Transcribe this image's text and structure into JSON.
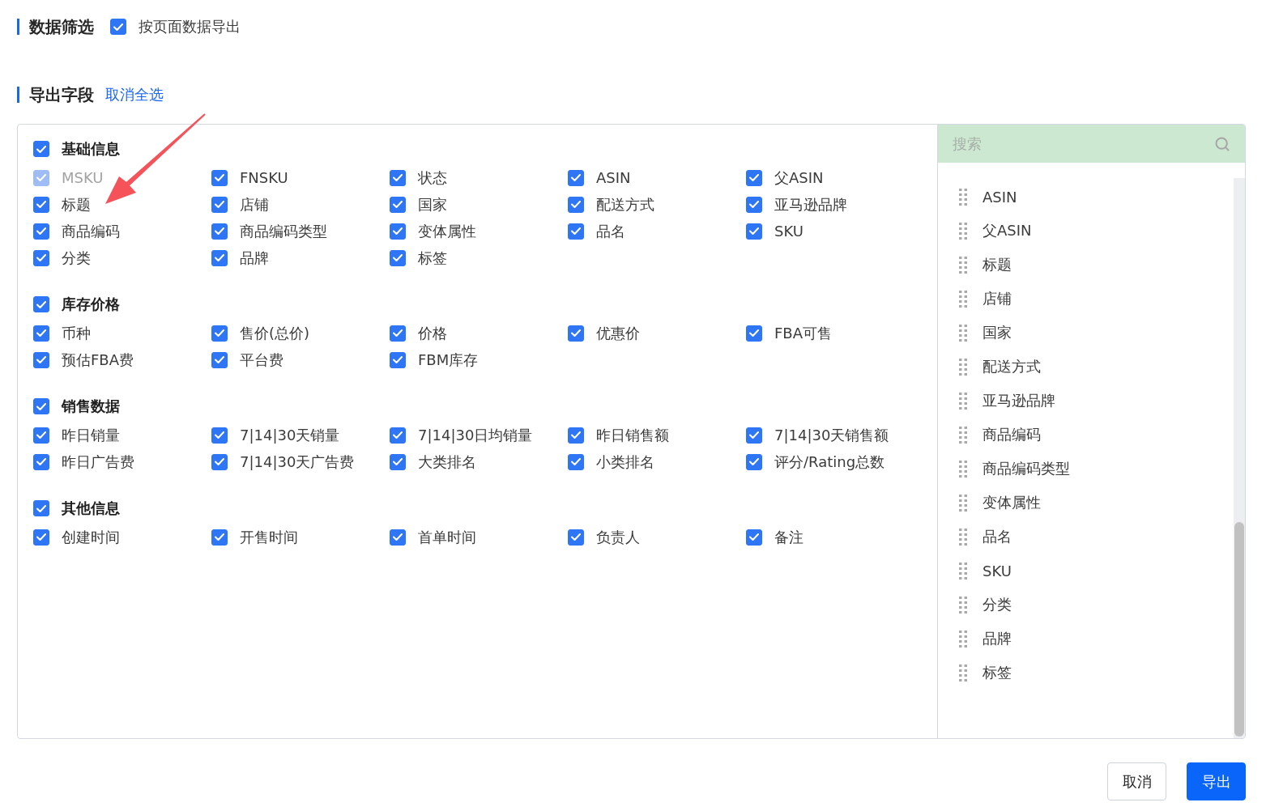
{
  "filter_section": {
    "title": "数据筛选",
    "option": {
      "label": "按页面数据导出",
      "checked": true
    }
  },
  "fields_section": {
    "title": "导出字段",
    "link": "取消全选"
  },
  "field_groups": [
    {
      "title": "基础信息",
      "checked": true,
      "fields": [
        {
          "label": "MSKU",
          "checked": true,
          "disabled": true
        },
        {
          "label": "FNSKU",
          "checked": true,
          "disabled": false
        },
        {
          "label": "状态",
          "checked": true,
          "disabled": false
        },
        {
          "label": "ASIN",
          "checked": true,
          "disabled": false
        },
        {
          "label": "父ASIN",
          "checked": true,
          "disabled": false
        },
        {
          "label": "标题",
          "checked": true,
          "disabled": false
        },
        {
          "label": "店铺",
          "checked": true,
          "disabled": false
        },
        {
          "label": "国家",
          "checked": true,
          "disabled": false
        },
        {
          "label": "配送方式",
          "checked": true,
          "disabled": false
        },
        {
          "label": "亚马逊品牌",
          "checked": true,
          "disabled": false
        },
        {
          "label": "商品编码",
          "checked": true,
          "disabled": false
        },
        {
          "label": "商品编码类型",
          "checked": true,
          "disabled": false
        },
        {
          "label": "变体属性",
          "checked": true,
          "disabled": false
        },
        {
          "label": "品名",
          "checked": true,
          "disabled": false
        },
        {
          "label": "SKU",
          "checked": true,
          "disabled": false
        },
        {
          "label": "分类",
          "checked": true,
          "disabled": false
        },
        {
          "label": "品牌",
          "checked": true,
          "disabled": false
        },
        {
          "label": "标签",
          "checked": true,
          "disabled": false
        }
      ]
    },
    {
      "title": "库存价格",
      "checked": true,
      "fields": [
        {
          "label": "币种",
          "checked": true,
          "disabled": false
        },
        {
          "label": "售价(总价)",
          "checked": true,
          "disabled": false
        },
        {
          "label": "价格",
          "checked": true,
          "disabled": false
        },
        {
          "label": "优惠价",
          "checked": true,
          "disabled": false
        },
        {
          "label": "FBA可售",
          "checked": true,
          "disabled": false
        },
        {
          "label": "预估FBA费",
          "checked": true,
          "disabled": false
        },
        {
          "label": "平台费",
          "checked": true,
          "disabled": false
        },
        {
          "label": "FBM库存",
          "checked": true,
          "disabled": false
        }
      ]
    },
    {
      "title": "销售数据",
      "checked": true,
      "fields": [
        {
          "label": "昨日销量",
          "checked": true,
          "disabled": false
        },
        {
          "label": "7|14|30天销量",
          "checked": true,
          "disabled": false
        },
        {
          "label": "7|14|30日均销量",
          "checked": true,
          "disabled": false
        },
        {
          "label": "昨日销售额",
          "checked": true,
          "disabled": false
        },
        {
          "label": "7|14|30天销售额",
          "checked": true,
          "disabled": false
        },
        {
          "label": "昨日广告费",
          "checked": true,
          "disabled": false
        },
        {
          "label": "7|14|30天广告费",
          "checked": true,
          "disabled": false
        },
        {
          "label": "大类排名",
          "checked": true,
          "disabled": false
        },
        {
          "label": "小类排名",
          "checked": true,
          "disabled": false
        },
        {
          "label": "评分/Rating总数",
          "checked": true,
          "disabled": false
        }
      ]
    },
    {
      "title": "其他信息",
      "checked": true,
      "fields": [
        {
          "label": "创建时间",
          "checked": true,
          "disabled": false
        },
        {
          "label": "开售时间",
          "checked": true,
          "disabled": false
        },
        {
          "label": "首单时间",
          "checked": true,
          "disabled": false
        },
        {
          "label": "负责人",
          "checked": true,
          "disabled": false
        },
        {
          "label": "备注",
          "checked": true,
          "disabled": false
        }
      ]
    }
  ],
  "search": {
    "placeholder": "搜索"
  },
  "selected_fields": [
    "ASIN",
    "父ASIN",
    "标题",
    "店铺",
    "国家",
    "配送方式",
    "亚马逊品牌",
    "商品编码",
    "商品编码类型",
    "变体属性",
    "品名",
    "SKU",
    "分类",
    "品牌",
    "标签"
  ],
  "buttons": [
    {
      "label": "取消",
      "kind": "secondary"
    },
    {
      "label": "导出",
      "kind": "primary"
    }
  ]
}
